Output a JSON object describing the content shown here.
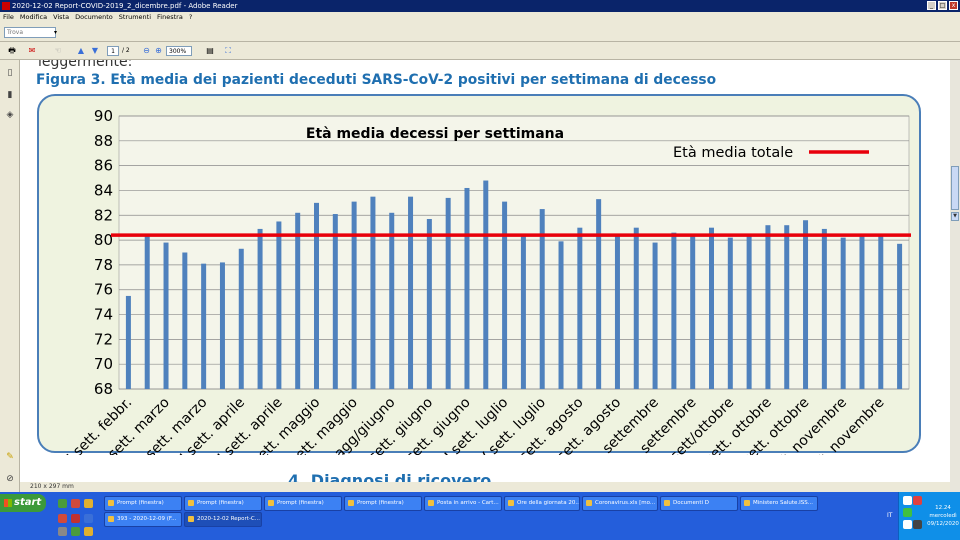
{
  "window": {
    "title": "2020-12-02 Report-COVID-2019_2_dicembre.pdf - Adobe Reader",
    "buttons": [
      "_",
      "□",
      "x"
    ]
  },
  "menu": [
    "File",
    "Modifica",
    "Vista",
    "Documento",
    "Strumenti",
    "Finestra",
    "?"
  ],
  "search": {
    "placeholder": "Trova"
  },
  "toolbar": {
    "page_current": "1",
    "page_total": "/ 2",
    "zoom": "300%"
  },
  "document": {
    "prev_text": "leggermente:",
    "figure_title": "Figura 3. Età media dei pazienti deceduti SARS-CoV-2 positivi per settimana di decesso",
    "next_heading": "4. Diagnosi di ricovero"
  },
  "statusbar": {
    "page_size": "210 x 297 mm"
  },
  "chart_data": {
    "type": "bar",
    "title": "Età media decessi per settimana",
    "xlabel": "",
    "ylabel": "",
    "ylim": [
      68,
      90
    ],
    "yticks": [
      68,
      70,
      72,
      74,
      76,
      78,
      80,
      82,
      84,
      86,
      88,
      90
    ],
    "grid": true,
    "legend_position": "top-right",
    "bar_color": "#4f81bd",
    "reference_line": {
      "name": "Età media totale",
      "value": 80.4,
      "color": "#e8000b"
    },
    "tick_labels": [
      "III sett. febbr.",
      "I sett. marzo",
      "III sett. marzo",
      "I sett. aprile",
      "III sett. aprile",
      "I sett. maggio",
      "III sett. maggio",
      "Sett. magg/giugno",
      "II sett. giugno",
      "IV sett. giugno",
      "II sett. luglio",
      "IV sett. luglio",
      "I sett. agosto",
      "III sett. agosto",
      "I sett. settembre",
      "III sett. settembre",
      "Sett. sett/ottobre",
      "II sett. ottobre",
      "IV sett. ottobre",
      "II sett. novembre",
      "IV sett. novembre"
    ],
    "values": [
      75.5,
      80.3,
      79.8,
      79.0,
      78.1,
      78.2,
      79.3,
      80.9,
      81.5,
      82.2,
      83.0,
      82.1,
      83.1,
      83.5,
      82.2,
      83.5,
      81.7,
      83.4,
      84.2,
      84.8,
      83.1,
      80.3,
      82.5,
      79.9,
      81.0,
      83.3,
      80.3,
      81.0,
      79.8,
      80.6,
      80.5,
      81.0,
      80.2,
      80.3,
      81.2,
      81.2,
      81.6,
      80.9,
      80.2,
      80.3,
      80.4,
      79.7
    ]
  },
  "taskbar": {
    "start_label": "start",
    "tasks_row1": [
      "Prompt (finestra)",
      "Prompt (finestra)",
      "Prompt (finestra)",
      "Prompt (finestra)",
      "Posta in arrivo - Cart...",
      "Ore della giornata 20...",
      "Coronavirus.xls [mo...",
      "Documenti D",
      "Ministero Salute.ISS..."
    ],
    "tasks_row2": [
      "393 - 2020-12-09 (F...",
      "2020-12-02 Report-C..."
    ],
    "language": "IT",
    "clock_time": "12.24",
    "clock_day": "mercoledì",
    "clock_date": "09/12/2020"
  }
}
